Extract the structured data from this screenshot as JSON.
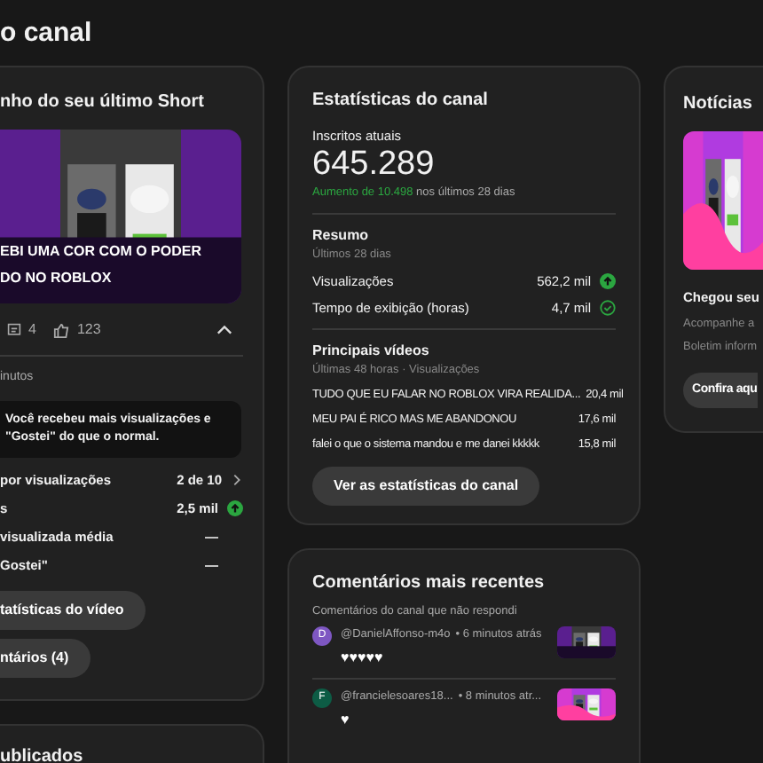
{
  "header": {
    "title": "o canal"
  },
  "short_card": {
    "title": "nho do seu último Short",
    "caption": [
      "EBI UMA COR COM O PODER",
      "DO NO ROBLOX"
    ],
    "comments": "4",
    "likes": "123",
    "expanded": true,
    "time": "inutos",
    "highlight": "Você recebeu mais visualizações e \"Gostei\" do que o normal.",
    "rows": [
      {
        "label": "por visualizações",
        "value": "2 de 10",
        "kind": "link"
      },
      {
        "label": "s",
        "value": "2,5 mil",
        "kind": "up"
      },
      {
        "label": "visualizada média",
        "value": "—",
        "kind": "plain"
      },
      {
        "label": "Gostei\"",
        "value": "—",
        "kind": "plain"
      }
    ],
    "buttons": [
      "tatísticas do vídeo",
      "ntários (4)"
    ]
  },
  "published_card": {
    "title": "ublicados"
  },
  "channel_stats": {
    "title": "Estatísticas do canal",
    "subscribers_label": "Inscritos atuais",
    "subscribers": "645.289",
    "growth": "Aumento de 10.498",
    "growth_suffix": " nos últimos 28 dias",
    "summary": {
      "title": "Resumo",
      "subtitle": "Últimos 28 dias",
      "rows": [
        {
          "label": "Visualizações",
          "value": "562,2 mil",
          "kind": "up"
        },
        {
          "label": "Tempo de exibição (horas)",
          "value": "4,7 mil",
          "kind": "check"
        }
      ]
    },
    "top_videos": {
      "title": "Principais vídeos",
      "subtitle": "Últimas 48 horas · Visualizações",
      "rows": [
        {
          "title": "TUDO QUE EU FALAR NO ROBLOX VIRA REALIDA...",
          "views": "20,4 mil"
        },
        {
          "title": "MEU PAI É RICO MAS ME ABANDONOU",
          "views": "17,6 mil"
        },
        {
          "title": "falei o que o sistema mandou e me danei kkkkk",
          "views": "15,8 mil"
        }
      ]
    },
    "button": "Ver as estatísticas do canal"
  },
  "recent_comments": {
    "title": "Comentários mais recentes",
    "subtitle": "Comentários do canal que não respondi",
    "items": [
      {
        "initial": "D",
        "color": "#7e57c2",
        "author": "@DanielAffonso-m4o",
        "time": "• 6 minutos atrás",
        "text": "♥♥♥♥♥"
      },
      {
        "initial": "F",
        "color": "#0d5c45",
        "author": "@francielesoares18...",
        "time": "• 8 minutos atr...",
        "text": "♥"
      }
    ]
  },
  "news": {
    "title": "Notícias",
    "headline": "Chegou seu",
    "lines": [
      "Acompanhe a",
      "Boletim inform"
    ],
    "button": "Confira aqu"
  }
}
